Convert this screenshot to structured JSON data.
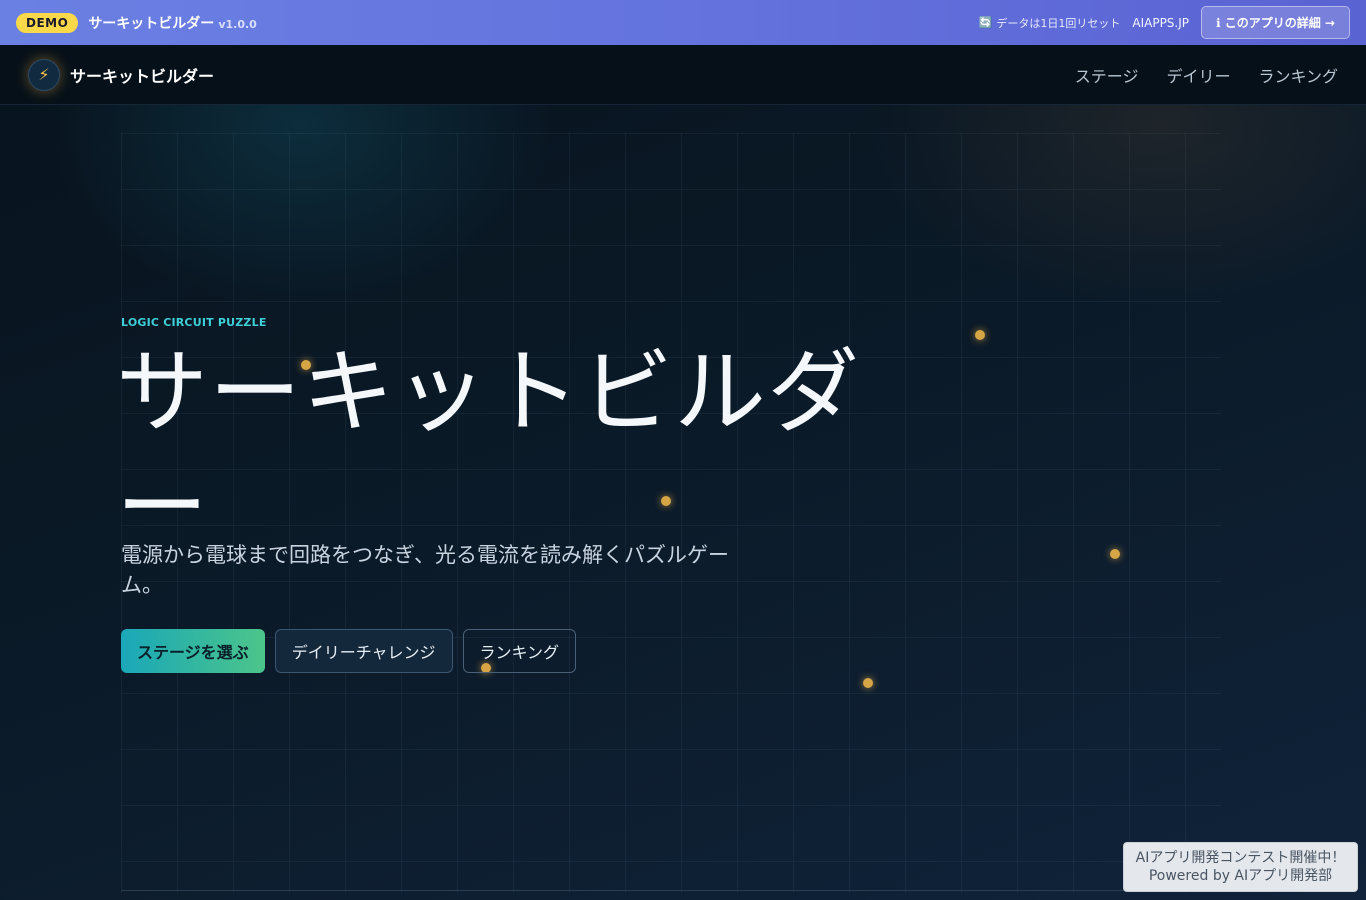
{
  "demo_bar": {
    "badge": "DEMO",
    "app_title": "サーキットビルダー",
    "version": "v1.0.0",
    "reset_icon": "🔄",
    "reset_note": "データは1日1回リセット",
    "site_link": "AIAPPS.JP",
    "detail_button": "ℹ このアプリの詳細 →"
  },
  "nav": {
    "logo_icon": "⚡",
    "brand": "サーキットビルダー",
    "links": [
      "ステージ",
      "デイリー",
      "ランキング"
    ]
  },
  "hero": {
    "tagline": "LOGIC CIRCUIT PUZZLE",
    "title": "サーキットビルダー",
    "description": "電源から電球まで回路をつなぎ、光る電流を読み解くパズルゲーム。",
    "buttons": {
      "primary": "ステージを選ぶ",
      "daily": "デイリーチャレンジ",
      "ranking": "ランキング"
    }
  },
  "promo": {
    "line1": "AIアプリ開発コンテスト開催中！",
    "line2": "Powered by AIアプリ開発部"
  },
  "colors": {
    "accent_teal": "#3ed0d8",
    "accent_green": "#4cc58a",
    "demo_badge": "#f9d949",
    "node_dot": "#d6a545"
  }
}
